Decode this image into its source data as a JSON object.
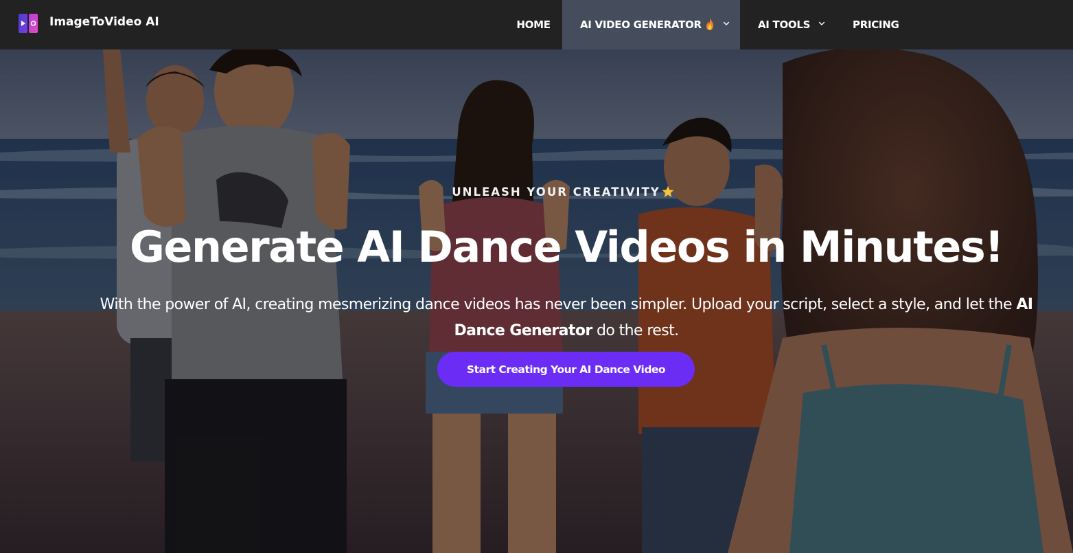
{
  "brand": {
    "name": "ImageToVideo AI",
    "logo_colors": [
      "#5b3fd6",
      "#c640c8"
    ]
  },
  "nav": {
    "items": [
      {
        "label": "HOME"
      },
      {
        "label": "AI VIDEO GENERATOR",
        "icon": "fire-icon",
        "has_dropdown": true,
        "active": true
      },
      {
        "label": "AI TOOLS",
        "has_dropdown": true
      },
      {
        "label": "PRICING"
      }
    ]
  },
  "hero": {
    "eyebrow": "UNLEASH YOUR CREATIVITY",
    "eyebrow_icon": "star-icon",
    "headline": "Generate AI Dance Videos in Minutes!",
    "subtext_before": "With the power of AI, creating mesmerizing dance videos has never been simpler. Upload your script, select a style, and let the ",
    "subtext_bold": "AI Dance Generator",
    "subtext_after": " do the rest.",
    "cta_label": "Start Creating Your AI Dance Video"
  },
  "colors": {
    "navbar_bg": "#222222",
    "active_nav_bg": "#454d5d",
    "cta_bg": "#6b2cf5",
    "text": "#ffffff"
  }
}
